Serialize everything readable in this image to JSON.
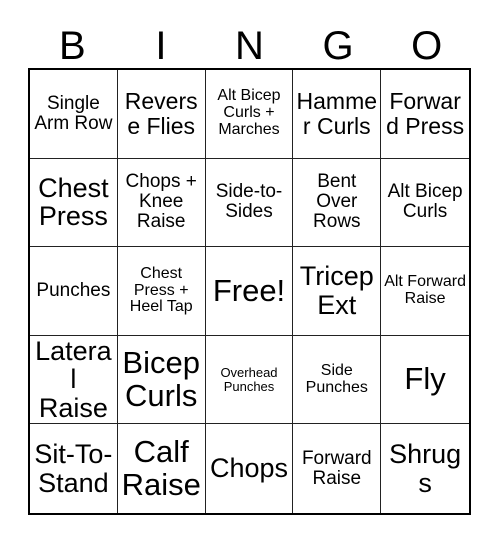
{
  "header": {
    "letters": [
      {
        "label": "B"
      },
      {
        "label": "I"
      },
      {
        "label": "N"
      },
      {
        "label": "G"
      },
      {
        "label": "O"
      }
    ]
  },
  "grid": {
    "columns": 5,
    "rows": 5,
    "border_color": "#000000",
    "cell_border_color": "#222222",
    "background": "#ffffff",
    "text_color": "#000000",
    "cells": [
      {
        "label": "Single Arm Row",
        "size": "md",
        "free": false
      },
      {
        "label": "Reverse Flies",
        "size": "lg",
        "free": false
      },
      {
        "label": "Alt Bicep Curls + Marches",
        "size": "sm",
        "free": false
      },
      {
        "label": "Hammer Curls",
        "size": "lg",
        "free": false
      },
      {
        "label": "Forward Press",
        "size": "lg",
        "free": false
      },
      {
        "label": "Chest Press",
        "size": "xl",
        "free": false
      },
      {
        "label": "Chops + Knee Raise",
        "size": "md",
        "free": false
      },
      {
        "label": "Side-to-Sides",
        "size": "md",
        "free": false
      },
      {
        "label": "Bent Over Rows",
        "size": "md",
        "free": false
      },
      {
        "label": "Alt Bicep Curls",
        "size": "md",
        "free": false
      },
      {
        "label": "Punches",
        "size": "md",
        "free": false
      },
      {
        "label": "Chest Press + Heel Tap",
        "size": "sm",
        "free": false
      },
      {
        "label": "Free!",
        "size": "xxl",
        "free": true
      },
      {
        "label": "Tricep Ext",
        "size": "xl",
        "free": false
      },
      {
        "label": "Alt Forward Raise",
        "size": "sm",
        "free": false
      },
      {
        "label": "Lateral Raise",
        "size": "xl",
        "free": false
      },
      {
        "label": "Bicep Curls",
        "size": "xxl",
        "free": false
      },
      {
        "label": "Overhead Punches",
        "size": "xs",
        "free": false
      },
      {
        "label": "Side Punches",
        "size": "sm",
        "free": false
      },
      {
        "label": "Fly",
        "size": "xxl",
        "free": false
      },
      {
        "label": "Sit-To-Stand",
        "size": "xl",
        "free": false
      },
      {
        "label": "Calf Raise",
        "size": "xxl",
        "free": false
      },
      {
        "label": "Chops",
        "size": "xl",
        "free": false
      },
      {
        "label": "Forward Raise",
        "size": "md",
        "free": false
      },
      {
        "label": "Shrugs",
        "size": "xl",
        "free": false
      }
    ]
  }
}
